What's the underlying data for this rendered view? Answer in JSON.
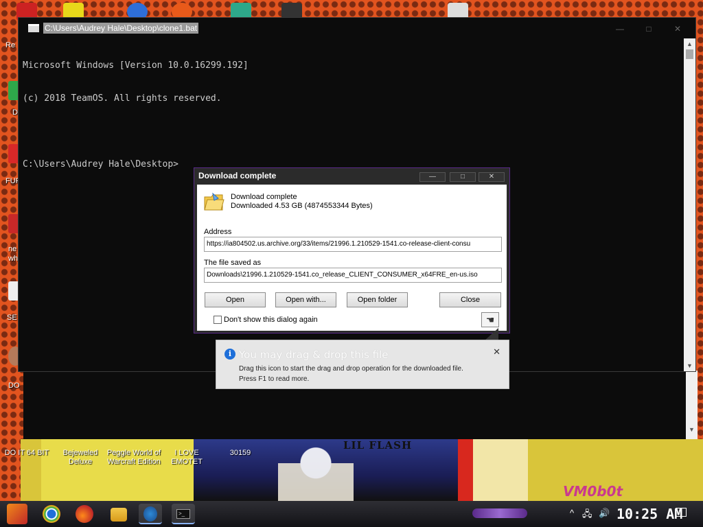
{
  "colors": {
    "terminal_bg": "#0c0c0c",
    "terminal_text": "#cccccc",
    "dialog_frame": "#2b2b2b",
    "accent": "#5a2a8a",
    "info_blue": "#1e6fd9"
  },
  "desktop": {
    "left_labels": [
      "Re",
      "D",
      "FUR",
      "ne",
      "wh",
      "SE",
      "DO"
    ],
    "bottom_icons": [
      {
        "label": "DO IT 64 BIT"
      },
      {
        "label": "Bejeweled Deluxe"
      },
      {
        "label": "Peggle World of Warcraft Edition"
      },
      {
        "label": "I LOVE EMOTET"
      },
      {
        "label": "30159"
      }
    ],
    "poster_title": "LIL FLASH",
    "watermark": "VM0b0t"
  },
  "terminal": {
    "title": "C:\\Users\\Audrey Hale\\Desktop\\clone1.bat",
    "controls": {
      "minimize": "—",
      "maximize": "□",
      "close": "✕"
    },
    "lines": [
      "Microsoft Windows [Version 10.0.16299.192]",
      "(c) 2018 TeamOS. All rights reserved.",
      "",
      "C:\\Users\\Audrey Hale\\Desktop>"
    ]
  },
  "download_dialog": {
    "title": "Download complete",
    "controls": {
      "minimize": "—",
      "maximize": "□",
      "close": "✕"
    },
    "heading": "Download complete",
    "size_text": "Downloaded 4.53  GB (4874553344 Bytes)",
    "address_label": "Address",
    "address_value": "https://ia804502.us.archive.org/33/items/21996.1.210529-1541.co-release-client-consu",
    "saved_label": "The file saved as",
    "saved_value": "Downloads\\21996.1.210529-1541.co_release_CLIENT_CONSUMER_x64FRE_en-us.iso",
    "buttons": {
      "open": "Open",
      "open_with": "Open with...",
      "open_folder": "Open folder",
      "close": "Close"
    },
    "checkbox_label": "Don't show this dialog again",
    "checkbox_checked": false
  },
  "tooltip": {
    "title": "You may drag & drop this file",
    "close": "✕",
    "text_line1": "Drag this icon to start the drag and drop operation for the downloaded file.",
    "text_line2": "Press F1 to read more."
  },
  "taskbar": {
    "apps": [
      "start-icon",
      "chrome-icon",
      "firefox-icon",
      "file-explorer-icon",
      "idm-icon",
      "cmd-icon"
    ],
    "tray_chevron": "^",
    "tray_network": "🖧",
    "tray_volume": "🔊",
    "clock": "10:25 AM"
  }
}
